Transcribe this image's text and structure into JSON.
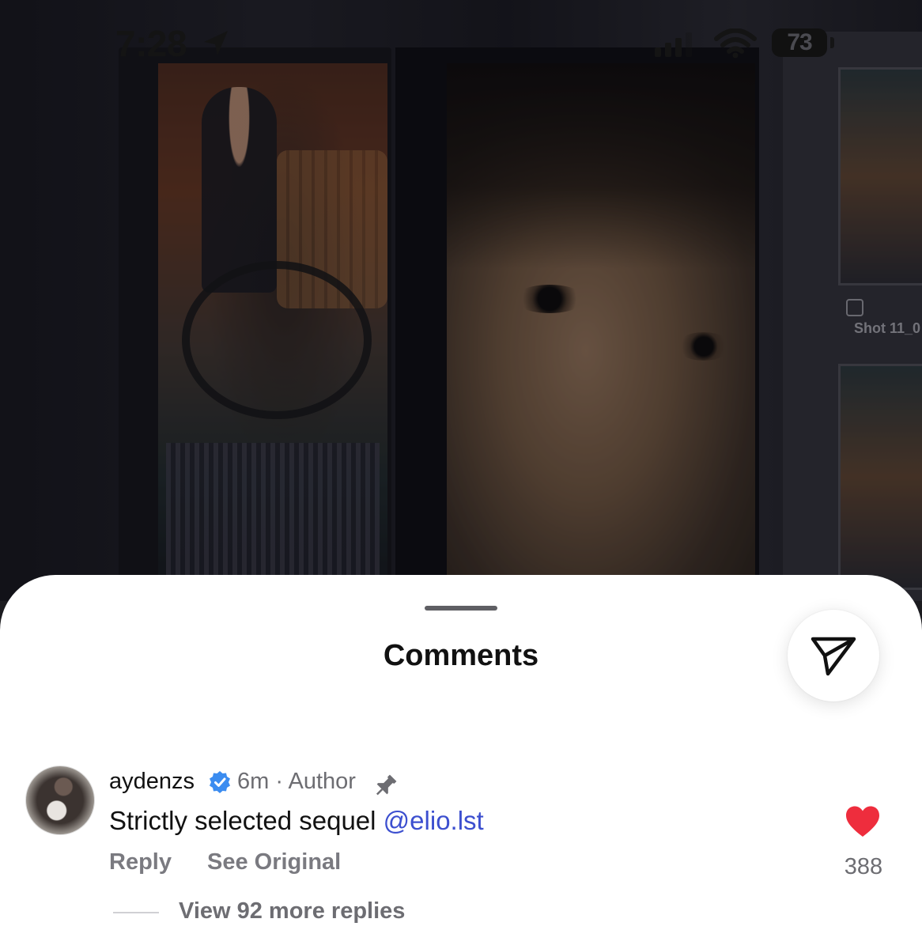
{
  "status_bar": {
    "time": "7:28",
    "battery": "73",
    "icons": [
      "location-arrow-icon",
      "cellular-signal-icon",
      "wifi-icon",
      "battery-icon"
    ]
  },
  "background": {
    "shot_label": "Shot 11_0"
  },
  "comments_sheet": {
    "title": "Comments",
    "share_icon": "paper-plane-icon",
    "comment": {
      "username": "aydenzs",
      "verified": true,
      "time": "6m",
      "separator": "·",
      "role": "Author",
      "pinned": true,
      "text": "Strictly selected sequel ",
      "mention": "@elio.lst",
      "reply_label": "Reply",
      "see_original_label": "See Original",
      "liked": true,
      "like_count": "388",
      "view_replies_label": "View 92 more replies"
    }
  },
  "colors": {
    "mention": "#3c4fcf",
    "heart": "#ee2d3d",
    "verified": "#3b8cf0"
  }
}
